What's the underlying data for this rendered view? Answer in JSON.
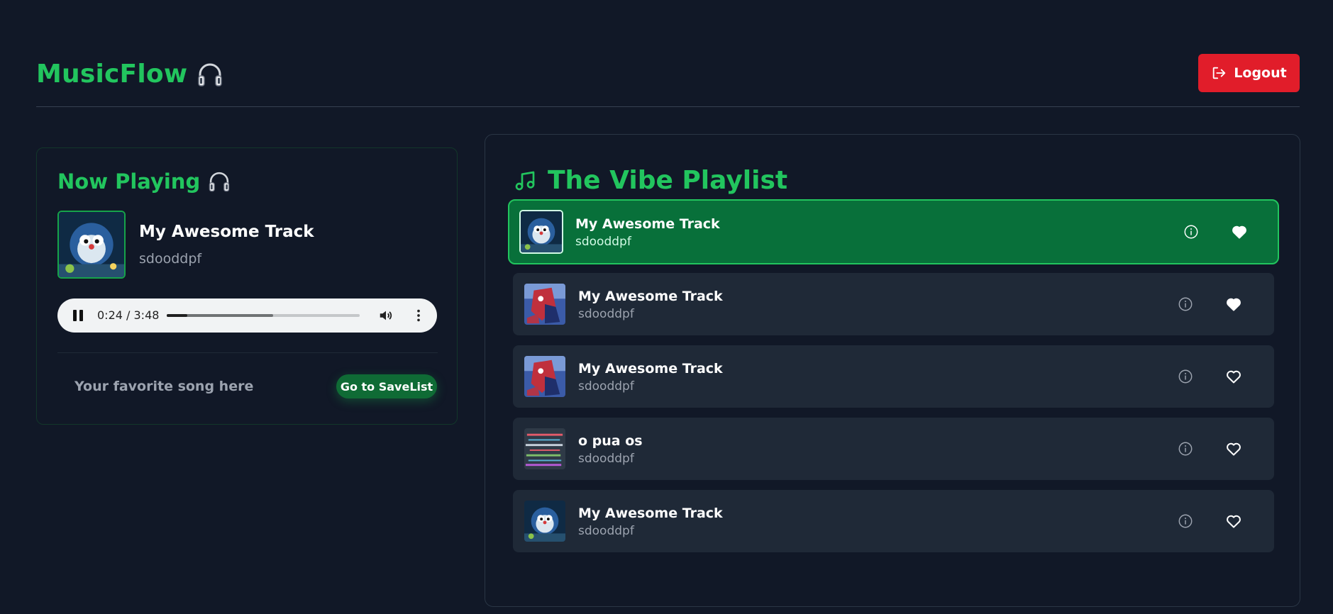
{
  "header": {
    "brand": "MusicFlow",
    "brand_icon": "headphones-icon",
    "logout_label": "Logout",
    "logout_icon": "sign-out-icon"
  },
  "now_playing": {
    "title": "Now Playing",
    "title_icon": "headphones-icon",
    "song": "My Awesome Track",
    "artist": "sdooddpf",
    "player": {
      "time_display": "0:24 / 3:48",
      "progress_fraction": 0.105
    },
    "favorite_text": "Your favorite song here",
    "savelist_label": "Go to SaveList"
  },
  "playlist": {
    "title": "The Vibe Playlist",
    "title_icon": "music-note-icon",
    "tracks": [
      {
        "song": "My Awesome Track",
        "artist": "sdooddpf",
        "cover": "blue-robot",
        "liked": true,
        "active": true
      },
      {
        "song": "My Awesome Track",
        "artist": "sdooddpf",
        "cover": "spider-hero",
        "liked": true,
        "active": false
      },
      {
        "song": "My Awesome Track",
        "artist": "sdooddpf",
        "cover": "spider-hero",
        "liked": false,
        "active": false
      },
      {
        "song": "o pua os",
        "artist": "sdooddpf",
        "cover": "glitch",
        "liked": false,
        "active": false
      },
      {
        "song": "My Awesome Track",
        "artist": "sdooddpf",
        "cover": "blue-robot",
        "liked": false,
        "active": false
      }
    ]
  },
  "colors": {
    "background": "#111827",
    "accent": "#22c55e",
    "active_row": "#08703a",
    "row": "#1f2937",
    "logout": "#e11d2a"
  }
}
